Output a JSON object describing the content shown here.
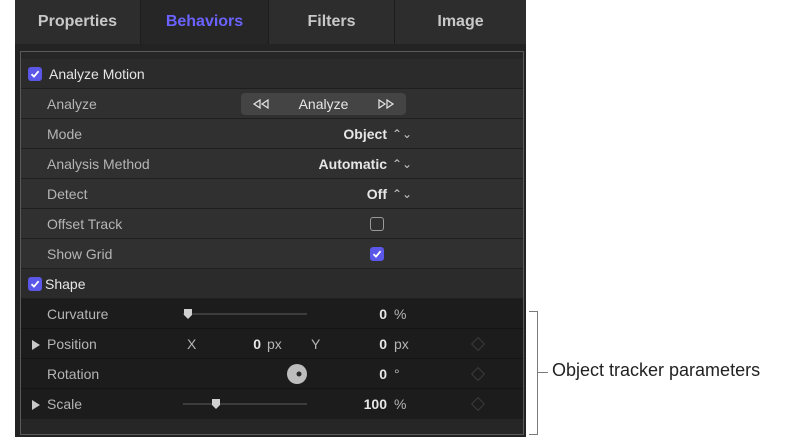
{
  "tabs": [
    "Properties",
    "Behaviors",
    "Filters",
    "Image"
  ],
  "analyze_motion": {
    "label": "Analyze Motion",
    "checked": true,
    "params": {
      "analyze": {
        "label": "Analyze",
        "button": "Analyze",
        "back_icon": "step-backward-icon",
        "forward_icon": "step-forward-icon"
      },
      "mode": {
        "label": "Mode",
        "value": "Object"
      },
      "method": {
        "label": "Analysis Method",
        "value": "Automatic"
      },
      "detect": {
        "label": "Detect",
        "value": "Off"
      },
      "offset_track": {
        "label": "Offset Track",
        "checked": false
      },
      "show_grid": {
        "label": "Show Grid",
        "checked": true
      }
    }
  },
  "shape": {
    "label": "Shape",
    "checked": true,
    "params": {
      "curvature": {
        "label": "Curvature",
        "value": "0",
        "unit": "%",
        "slider": 0
      },
      "position": {
        "label": "Position",
        "x_label": "X",
        "x": "0",
        "x_unit": "px",
        "y_label": "Y",
        "y": "0",
        "y_unit": "px"
      },
      "rotation": {
        "label": "Rotation",
        "value": "0",
        "unit": "°"
      },
      "scale": {
        "label": "Scale",
        "value": "100",
        "unit": "%",
        "slider": 0.33
      }
    }
  },
  "callout": "Object tracker parameters",
  "colors": {
    "accent": "#5b57e8",
    "active_tab": "#6b63ff"
  }
}
